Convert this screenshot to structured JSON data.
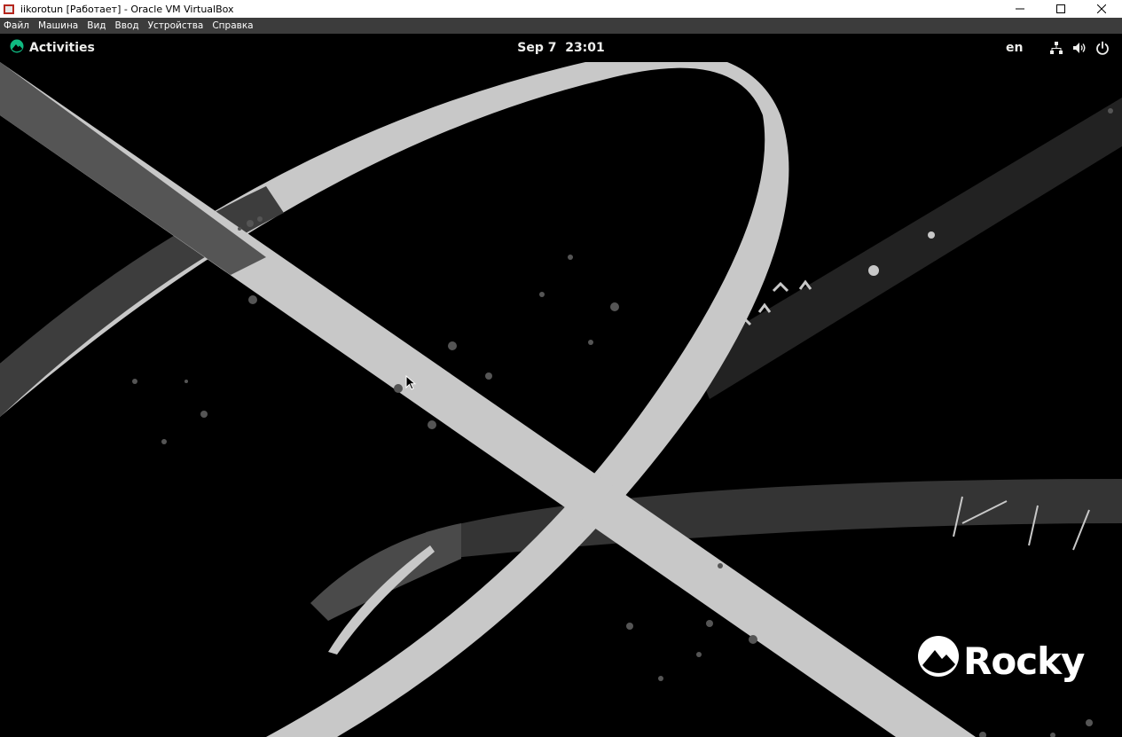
{
  "host_window": {
    "title": "iikorotun [Работает] - Oracle VM VirtualBox",
    "icon": "virtualbox-icon",
    "controls": [
      "minimize-icon",
      "maximize-icon",
      "close-icon"
    ]
  },
  "vbox_menu": {
    "items": [
      "Файл",
      "Машина",
      "Вид",
      "Ввод",
      "Устройства",
      "Справка"
    ]
  },
  "gnome_topbar": {
    "activities_label": "Activities",
    "clock": "Sep 7  23:01",
    "language": "en",
    "status_icons": [
      "network-icon",
      "volume-icon",
      "power-icon"
    ]
  },
  "desktop": {
    "brand_logo_text": "Rocky",
    "wallpaper_colors": {
      "background": "#000000",
      "stripe": "#c8c8c8",
      "accent_green": "#10b981"
    }
  }
}
